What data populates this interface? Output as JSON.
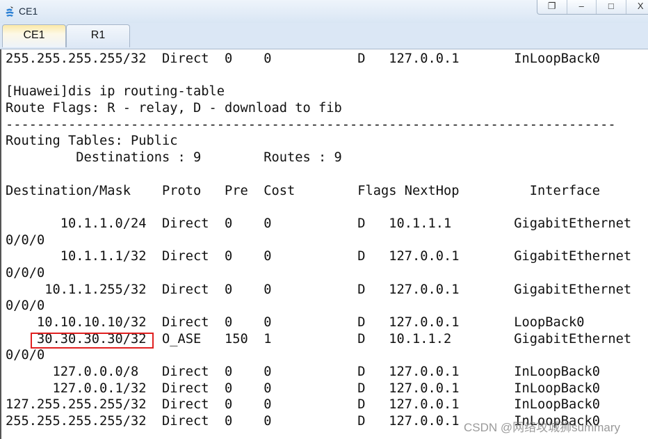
{
  "window": {
    "title": "CE1",
    "controls": [
      "restore",
      "minimize",
      "maximize",
      "close"
    ],
    "close_label": "X"
  },
  "tabs": [
    {
      "label": "CE1",
      "active": true
    },
    {
      "label": "R1",
      "active": false
    }
  ],
  "console": {
    "lines": [
      "255.255.255.255/32  Direct  0    0           D   127.0.0.1       InLoopBack0",
      "",
      "[Huawei]dis ip routing-table",
      "Route Flags: R - relay, D - download to fib",
      "------------------------------------------------------------------------------",
      "Routing Tables: Public",
      "         Destinations : 9        Routes : 9",
      "",
      "Destination/Mask    Proto   Pre  Cost        Flags NextHop         Interface",
      "",
      "       10.1.1.0/24  Direct  0    0           D   10.1.1.1        GigabitEthernet",
      "0/0/0",
      "       10.1.1.1/32  Direct  0    0           D   127.0.0.1       GigabitEthernet",
      "0/0/0",
      "     10.1.1.255/32  Direct  0    0           D   127.0.0.1       GigabitEthernet",
      "0/0/0",
      "    10.10.10.10/32  Direct  0    0           D   127.0.0.1       LoopBack0",
      "    30.30.30.30/32  O_ASE   150  1           D   10.1.1.2        GigabitEthernet",
      "0/0/0",
      "      127.0.0.0/8   Direct  0    0           D   127.0.0.1       InLoopBack0",
      "      127.0.0.1/32  Direct  0    0           D   127.0.0.1       InLoopBack0",
      "127.255.255.255/32  Direct  0    0           D   127.0.0.1       InLoopBack0",
      "255.255.255.255/32  Direct  0    0           D   127.0.0.1       InLoopBack0"
    ],
    "highlight_color": "#e02020"
  },
  "watermark": "CSDN @网络攻城狮summary"
}
